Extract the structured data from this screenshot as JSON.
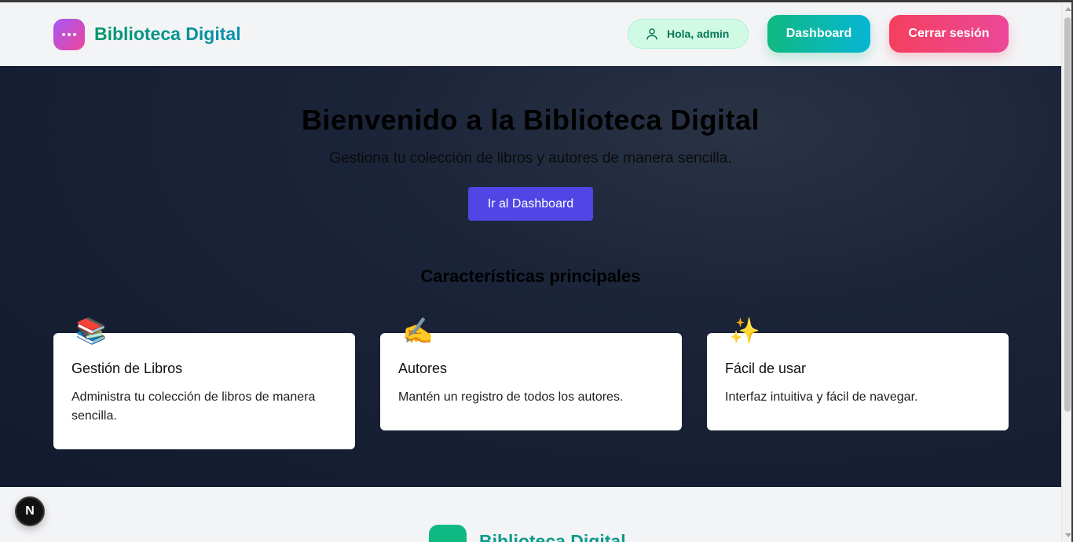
{
  "header": {
    "brand": "Biblioteca Digital",
    "greeting": "Hola, admin",
    "dashboard_label": "Dashboard",
    "logout_label": "Cerrar sesión"
  },
  "hero": {
    "title": "Bienvenido a la Biblioteca Digital",
    "subtitle": "Gestiona tu colección de libros y autores de manera sencilla.",
    "cta_label": "Ir al Dashboard"
  },
  "features": {
    "heading": "Características principales",
    "items": [
      {
        "emoji": "📚",
        "title": "Gestión de Libros",
        "description": "Administra tu colección de libros de manera sencilla."
      },
      {
        "emoji": "✍️",
        "title": "Autores",
        "description": "Mantén un registro de todos los autores."
      },
      {
        "emoji": "✨",
        "title": "Fácil de usar",
        "description": "Interfaz intuitiva y fácil de navegar."
      }
    ]
  },
  "footer": {
    "brand": "Biblioteca Digital"
  },
  "dev_badge": {
    "label": "N"
  },
  "icons": {
    "logo": "dots-icon",
    "user": "user-icon"
  },
  "colors": {
    "brand_gradient_start": "#059669",
    "brand_gradient_end": "#0891b2",
    "dashboard_button_start": "#10b981",
    "dashboard_button_end": "#06b6d4",
    "logout_button_start": "#f43f5e",
    "logout_button_end": "#ec4899",
    "cta_button": "#4f46e5",
    "hero_background": "#1b2438"
  }
}
